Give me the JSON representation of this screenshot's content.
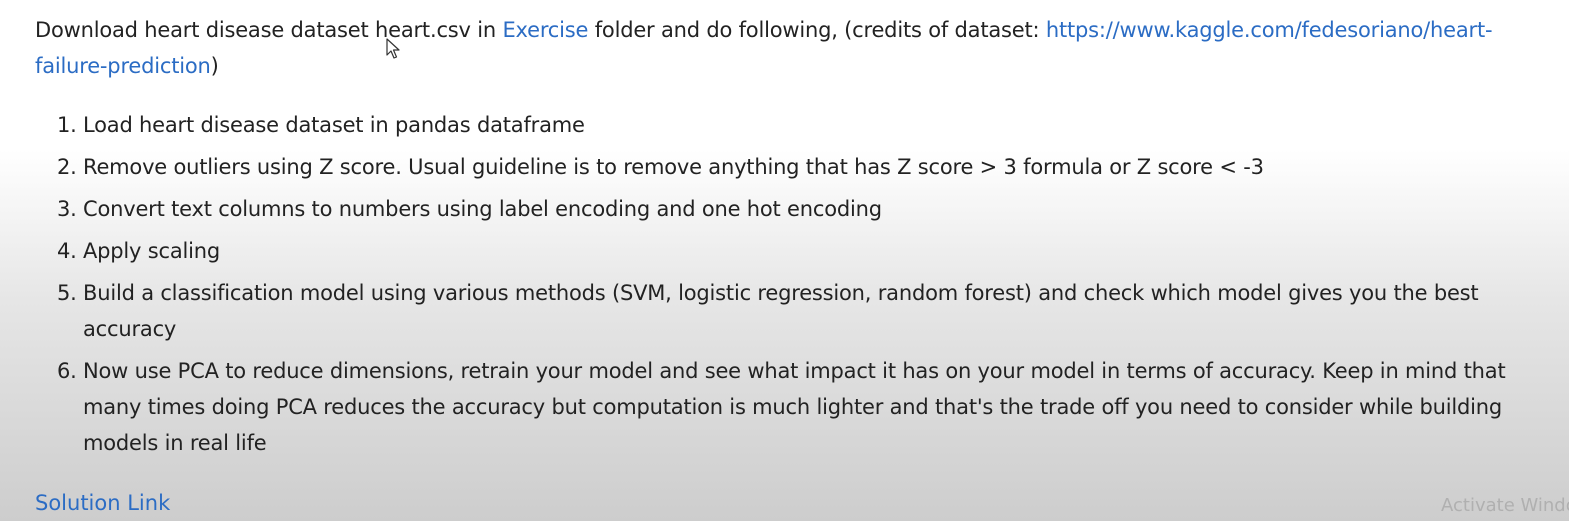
{
  "intro": {
    "text_before": "Download heart disease dataset heart.csv in ",
    "exercise_link": "Exercise",
    "text_middle": " folder and do following, (credits of dataset: ",
    "dataset_link": "https://www.kaggle.com/fedesoriano/heart-failure-prediction",
    "text_after": ")"
  },
  "tasks": [
    {
      "num": "1.",
      "text": "Load heart disease dataset in pandas dataframe"
    },
    {
      "num": "2.",
      "text": "Remove outliers using Z score. Usual guideline is to remove anything that has Z score > 3 formula or Z score < -3"
    },
    {
      "num": "3.",
      "text": "Convert text columns to numbers using label encoding and one hot encoding"
    },
    {
      "num": "4.",
      "text": "Apply scaling"
    },
    {
      "num": "5.",
      "text": "Build a classification model using various methods (SVM, logistic regression, random forest) and check which model gives you the best accuracy"
    },
    {
      "num": "6.",
      "text": "Now use PCA to reduce dimensions, retrain your model and see what impact it has on your model in terms of accuracy. Keep in mind that many times doing PCA reduces the accuracy but computation is much lighter and that's the trade off you need to consider while building models in real life"
    }
  ],
  "solution_link": "Solution Link",
  "watermark": "Activate Windo",
  "colors": {
    "link": "#2b6cc4",
    "text": "#222222"
  }
}
